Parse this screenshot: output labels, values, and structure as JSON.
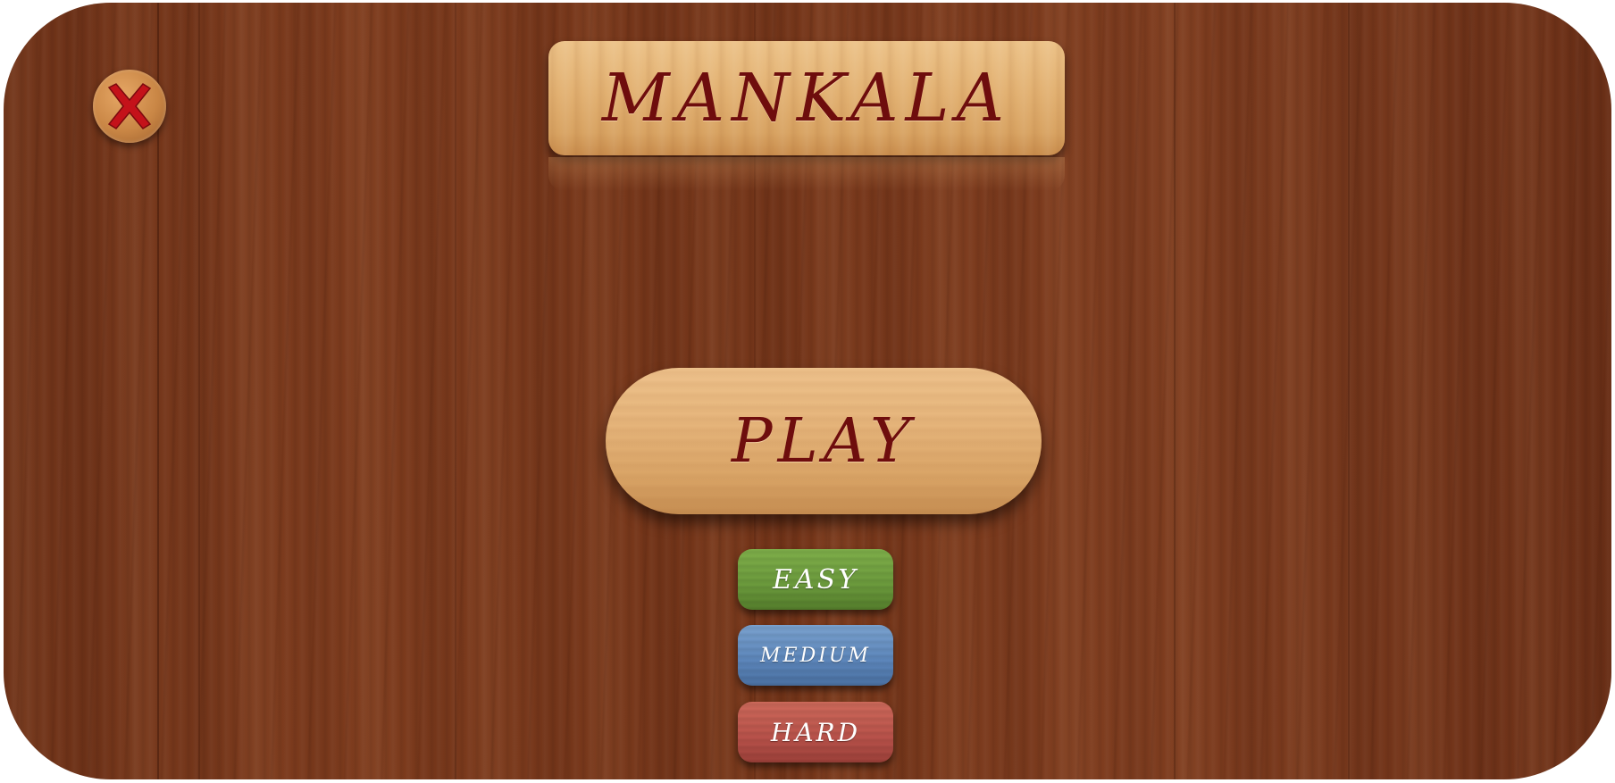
{
  "game": {
    "title": "MANKALA",
    "play_label": "PLAY",
    "difficulty": [
      {
        "label": "EASY",
        "color": "#6b9a3c"
      },
      {
        "label": "MEDIUM",
        "color": "#5c86bb"
      },
      {
        "label": "HARD",
        "color": "#b9524a"
      }
    ]
  },
  "close_icon": "close-icon",
  "colors": {
    "board_wood": "#763719",
    "plank_wood": "#e2b172",
    "title_text": "#6e0d0d",
    "close_x": "#c4121a"
  }
}
